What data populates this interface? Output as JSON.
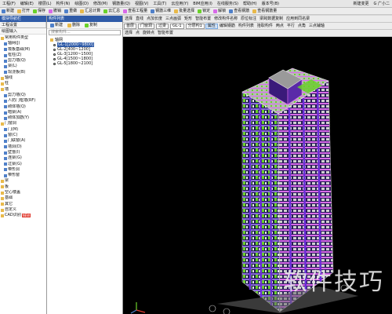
{
  "menu": {
    "items": [
      "工程(F)",
      "编辑(E)",
      "楼层(L)",
      "构件(N)",
      "绘图(D)",
      "修改(M)",
      "钢筋量(Q)",
      "视图(V)",
      "工具(T)",
      "云应用(Y)",
      "BIM应用(I)",
      "在线服务(S)",
      "帮助(H)",
      "版本号(B)"
    ],
    "right_items": [
      "新建变更",
      "G 广小二"
    ]
  },
  "toolbar1": {
    "items": [
      "新建",
      "打开",
      "保存",
      "撤销",
      "重做",
      "汇总计算",
      "云汇总",
      "查看工程量",
      "钢筋三维",
      "批量选择",
      "锁定",
      "解锁",
      "查看钢筋",
      "查看钢筋量"
    ]
  },
  "left_panel": {
    "title": "模块导航栏",
    "tabs": [
      "工程设置",
      "绘图输入"
    ],
    "tree": [
      {
        "text": "常用构件类型",
        "icon": "folder-icon",
        "level": 0
      },
      {
        "text": "轴网(J)",
        "icon": "item-icon",
        "level": 1
      },
      {
        "text": "筏板基础(M)",
        "icon": "item-icon",
        "level": 1
      },
      {
        "text": "框柱(Z)",
        "icon": "item-icon",
        "level": 1
      },
      {
        "text": "剪力墙(Q)",
        "icon": "item-icon",
        "level": 1
      },
      {
        "text": "梁(L)",
        "icon": "item-icon",
        "level": 1
      },
      {
        "text": "现浇板(B)",
        "icon": "item-icon",
        "level": 1
      },
      {
        "text": "轴线",
        "icon": "folder-icon",
        "level": 0
      },
      {
        "text": "柱",
        "icon": "folder-icon",
        "level": 0
      },
      {
        "text": "墙",
        "icon": "folder-icon",
        "level": 0
      },
      {
        "text": "剪力墙(Q)",
        "icon": "item-icon",
        "level": 1
      },
      {
        "text": "人防门框墙(RF)",
        "icon": "item-icon",
        "level": 1
      },
      {
        "text": "砌体墙(Q)",
        "icon": "item-icon",
        "level": 1
      },
      {
        "text": "暗梁(A)",
        "icon": "item-icon",
        "level": 1
      },
      {
        "text": "砌体加筋(Y)",
        "icon": "item-icon",
        "level": 1
      },
      {
        "text": "门窗洞",
        "icon": "folder-icon",
        "level": 0
      },
      {
        "text": "门(M)",
        "icon": "item-icon",
        "level": 1
      },
      {
        "text": "窗(C)",
        "icon": "item-icon",
        "level": 1
      },
      {
        "text": "门联窗(A)",
        "icon": "item-icon",
        "level": 1
      },
      {
        "text": "墙洞(D)",
        "icon": "item-icon",
        "level": 1
      },
      {
        "text": "壁龛(I)",
        "icon": "item-icon",
        "level": 1
      },
      {
        "text": "连梁(G)",
        "icon": "item-icon",
        "level": 1
      },
      {
        "text": "过梁(G)",
        "icon": "item-icon",
        "level": 1
      },
      {
        "text": "带形洞",
        "icon": "item-icon",
        "level": 1
      },
      {
        "text": "带形窗",
        "icon": "item-icon",
        "level": 1
      },
      {
        "text": "梁",
        "icon": "folder-icon",
        "level": 0
      },
      {
        "text": "板",
        "icon": "folder-icon",
        "level": 0
      },
      {
        "text": "空心楼盖",
        "icon": "folder-icon",
        "level": 0
      },
      {
        "text": "基础",
        "icon": "folder-icon",
        "level": 0
      },
      {
        "text": "其它",
        "icon": "folder-icon",
        "level": 0
      },
      {
        "text": "自定义",
        "icon": "folder-icon",
        "level": 0
      },
      {
        "text": "CAD识别",
        "icon": "folder-icon",
        "level": 0,
        "badge": "NEW"
      }
    ]
  },
  "mid_panel": {
    "title": "构件列表",
    "toolbar": [
      "新建",
      "删除",
      "复制"
    ],
    "search_placeholder": "搜索构件...",
    "root": "轴网",
    "floors": [
      {
        "text": "GL-1[2000~9800]",
        "selected": true
      },
      {
        "text": "GL-2[400~1200]",
        "selected": false
      },
      {
        "text": "GL-3[1200~1500]",
        "selected": false
      },
      {
        "text": "GL-4[1500~1800]",
        "selected": false
      },
      {
        "text": "GL-5[1800~2100]",
        "selected": false
      }
    ]
  },
  "canvas_toolbar": {
    "row1": [
      "选择",
      "直线",
      "点加长度",
      "三点画弧",
      "矩形",
      "智能布置",
      "修改构件名称",
      "原位标注",
      "梁跨数据复制",
      "应用到同名梁"
    ],
    "row2": {
      "layer": "首层",
      "type": "门窗洞",
      "category": "过梁",
      "name": "GL-1",
      "view": "分层构1",
      "buttons": [
        "属性",
        "编辑钢筋",
        "构件列表",
        "拾取构件"
      ],
      "right": [
        "两点",
        "平行",
        "点角",
        "三点辅轴"
      ]
    },
    "row3": [
      "选择",
      "点",
      "旋转点",
      "智能布置"
    ]
  },
  "watermark": "软件技巧",
  "colors": {
    "menu_bg": "#e6e6e6",
    "panel_title_bg": "#2f5ba8",
    "viewport_bg": "#000000",
    "accent_green": "#6ad12a",
    "accent_magenta": "#d86ae8",
    "accent_purple": "#6a2dd8"
  }
}
